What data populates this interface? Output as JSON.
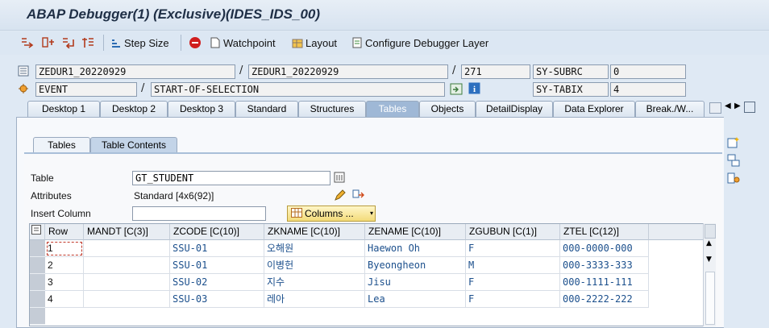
{
  "window": {
    "title": "ABAP Debugger(1)  (Exclusive)(IDES_IDS_00)"
  },
  "toolbar": {
    "step_size": "Step Size",
    "watchpoint": "Watchpoint",
    "layout": "Layout",
    "configure": "Configure Debugger Layer"
  },
  "header": {
    "program": "ZEDUR1_20220929",
    "include": "ZEDUR1_20220929",
    "line": "271",
    "sysubrc_label": "SY-SUBRC",
    "sysubrc_value": "0",
    "event_type": "EVENT",
    "event_name": "START-OF-SELECTION",
    "sytabix_label": "SY-TABIX",
    "sytabix_value": "4"
  },
  "main_tabs": [
    "Desktop 1",
    "Desktop 2",
    "Desktop 3",
    "Standard",
    "Structures",
    "Tables",
    "Objects",
    "DetailDisplay",
    "Data Explorer",
    "Break./W..."
  ],
  "sub_tabs": [
    "Tables",
    "Table Contents"
  ],
  "form": {
    "table_label": "Table",
    "table_value": "GT_STUDENT",
    "attributes_label": "Attributes",
    "attributes_value": "Standard [4x6(92)]",
    "insert_column_label": "Insert Column",
    "insert_column_value": "",
    "columns_button": "Columns ..."
  },
  "grid": {
    "headers": [
      "Row",
      "MANDT [C(3)]",
      "ZCODE [C(10)]",
      "ZKNAME [C(10)]",
      "ZENAME [C(10)]",
      "ZGUBUN [C(1)]",
      "ZTEL [C(12)]"
    ],
    "rows": [
      [
        "1",
        "",
        "SSU-01",
        "오해원",
        "Haewon Oh",
        "F",
        "000-0000-000"
      ],
      [
        "2",
        "",
        "SSU-01",
        "이병헌",
        "Byeongheon",
        "M",
        "000-3333-333"
      ],
      [
        "3",
        "",
        "SSU-02",
        "지수",
        "Jisu",
        "F",
        "000-1111-111"
      ],
      [
        "4",
        "",
        "SSU-03",
        "레아",
        "Lea",
        "F",
        "000-2222-222"
      ]
    ]
  },
  "colors": {
    "grid_text": "#1b4f8c",
    "selected_tab": "#9fb8d6",
    "background": "#dfe9f4"
  }
}
